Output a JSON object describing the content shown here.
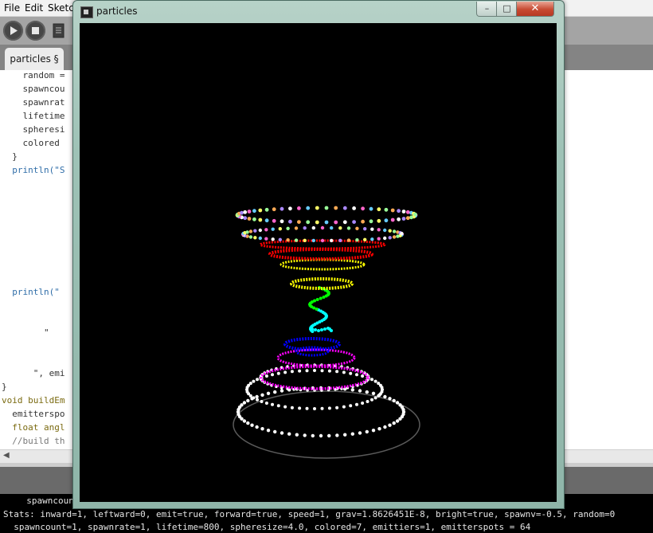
{
  "ide": {
    "menu": [
      "File",
      "Edit",
      "Sketch"
    ],
    "tab_label": "particles §",
    "code_lines": [
      "    random =",
      "    spawncou",
      "    spawnrat",
      "    lifetime",
      "    spheresi",
      "    colored ",
      "  }",
      "  println(\"S",
      "  println(\"",
      "        \"",
      "      \", emi",
      "}",
      "void buildEm",
      "  emitterspo",
      "  float angl",
      "  //build th"
    ],
    "console": {
      "line1": "  spawncount",
      "line2": "Stats: inward=1, leftward=0, emit=true, forward=true, speed=1, grav=1.8626451E-8, bright=true, spawnv=-0.5, random=0",
      "line3": "  spawncount=1, spawnrate=1, lifetime=800, spheresize=4.0, colored=7, emittiers=1, emitterspots = 64"
    }
  },
  "sketch_window": {
    "title": "particles",
    "controls": {
      "minimize": "–",
      "maximize": "□",
      "close": "✕"
    },
    "icon": "processing-app-icon"
  },
  "colors": {
    "canvas_background": "#000000",
    "spiral_colors": [
      "#ffffff",
      "#ff00ff",
      "#0000ff",
      "#00ffff",
      "#00ff00",
      "#ffff00",
      "#ff0000"
    ],
    "multicolor_ring": [
      "#ff66cc",
      "#66ccff",
      "#ffff66",
      "#99ff99",
      "#ffaa55",
      "#aa88ff",
      "#ffffff"
    ]
  }
}
